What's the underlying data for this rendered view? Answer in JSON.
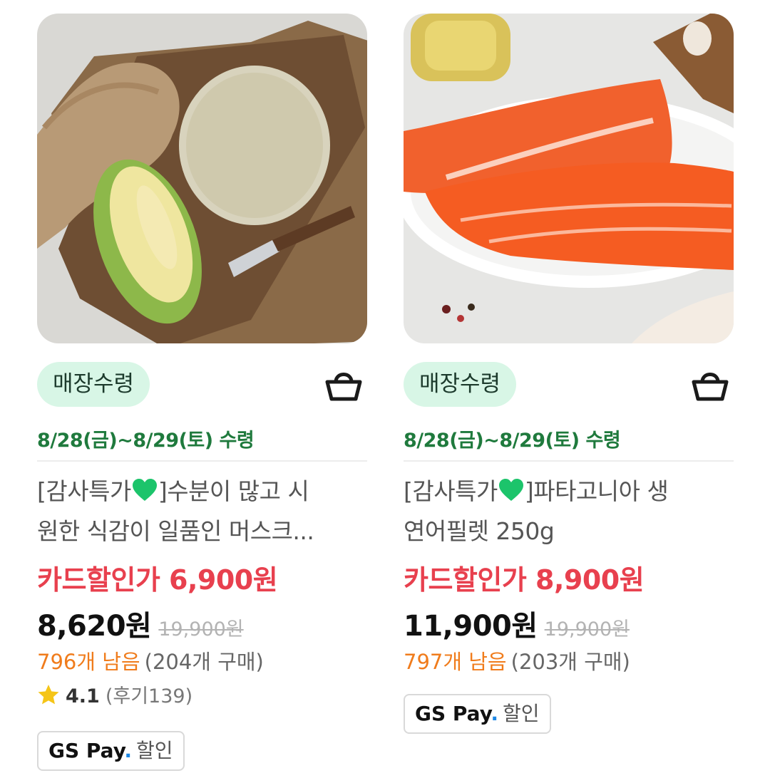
{
  "products": [
    {
      "image": "melon-photo",
      "badge": "매장수령",
      "pickup_date": "8/28(금)~8/29(토) 수령",
      "title_prefix": "[감사특가",
      "title_line1_rest": "]수분이 많고 시",
      "title_line2": "원한 식감이 일품인 머스크...",
      "card_price": "카드할인가 6,900원",
      "sale_price": "8,620원",
      "original_price": "19,900원",
      "stock_left": "796개 남음",
      "sold_count": "(204개 구매)",
      "rating": "4.1",
      "review_count": "(후기139)",
      "gspay_brand": "GS Pay",
      "gspay_dot": ".",
      "gspay_label": "할인"
    },
    {
      "image": "salmon-photo",
      "badge": "매장수령",
      "pickup_date": "8/28(금)~8/29(토) 수령",
      "title_prefix": "[감사특가",
      "title_line1_rest": "]파타고니아 생",
      "title_line2": "연어필렛 250g",
      "card_price": "카드할인가 8,900원",
      "sale_price": "11,900원",
      "original_price": "19,900원",
      "stock_left": "797개 남음",
      "sold_count": "(203개 구매)",
      "gspay_brand": "GS Pay",
      "gspay_dot": ".",
      "gspay_label": "할인"
    }
  ],
  "icons": {
    "cart": "basket-icon",
    "heart": "green-heart-icon",
    "star": "star-icon"
  },
  "colors": {
    "pickup_green": "#1f7a3d",
    "badge_bg": "#d8f6e6",
    "card_price_red": "#e8404e",
    "stock_orange": "#f07c1c",
    "star_yellow": "#f5c518",
    "gspay_blue": "#1e88e5"
  }
}
